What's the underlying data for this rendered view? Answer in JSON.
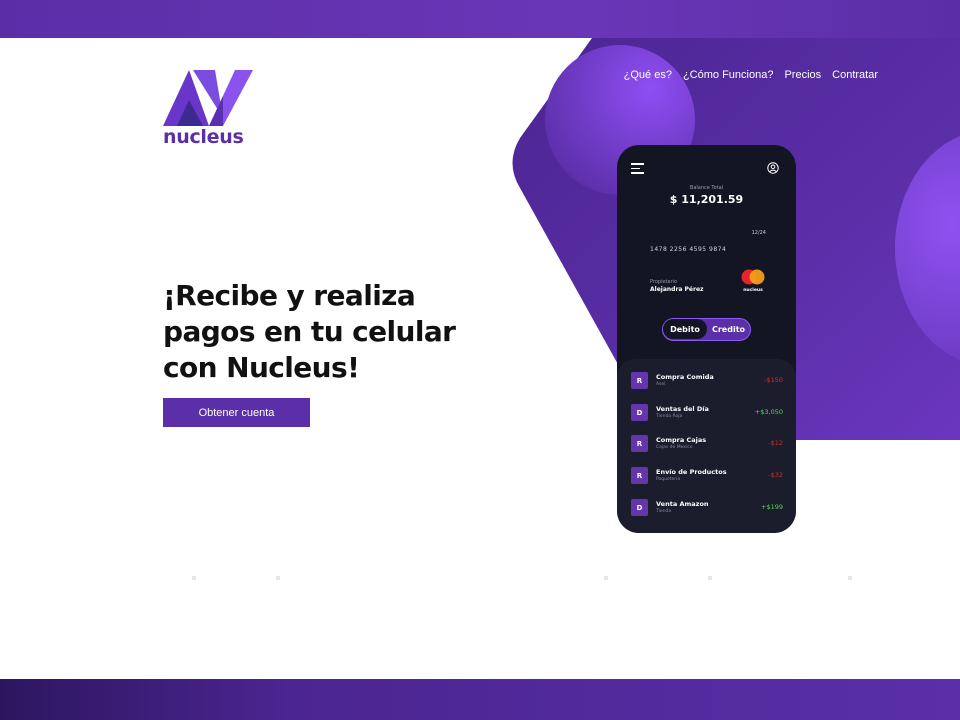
{
  "brand": {
    "name": "nucleus"
  },
  "nav": {
    "items": [
      "¿Qué es?",
      "¿Cómo Funciona?",
      "Precios",
      "Contratar"
    ]
  },
  "hero": {
    "headline_line1": "¡Recibe y realiza",
    "headline_line2": "pagos en tu celular",
    "headline_line3": "con Nucleus!",
    "cta_label": "Obtener cuenta"
  },
  "phone": {
    "balance_label": "Balance Total",
    "balance_value": "$ 11,201.59",
    "card": {
      "expiry": "12/24",
      "number": "1478 2256 4595 9874",
      "owner_label": "Propietario",
      "owner_name": "Alejandra Pérez",
      "network_label": "nucleus"
    },
    "toggle": {
      "debit": "Debito",
      "credit": "Credito",
      "selected": "Debito"
    },
    "transactions": [
      {
        "badge": "R",
        "title": "Compra Comida",
        "subtitle": "Asel",
        "amount": "-$150",
        "type": "negative"
      },
      {
        "badge": "D",
        "title": "Ventas del Día",
        "subtitle": "Tienda Roja",
        "amount": "+$3,050",
        "type": "positive"
      },
      {
        "badge": "R",
        "title": "Compra Cajas",
        "subtitle": "Cajas de Mexico",
        "amount": "-$12",
        "type": "negative"
      },
      {
        "badge": "R",
        "title": "Envío de Productos",
        "subtitle": "Paquetería",
        "amount": "-$32",
        "type": "negative"
      },
      {
        "badge": "D",
        "title": "Venta Amazon",
        "subtitle": "Tienda",
        "amount": "+$199",
        "type": "positive"
      }
    ]
  },
  "colors": {
    "brand_purple": "#5b2fa8",
    "accent_violet": "#8b5cf6",
    "phone_bg": "#141523",
    "negative": "#e5252a",
    "positive": "#4ade4a"
  },
  "icons": [
    "menu-icon",
    "profile-icon",
    "mastercard-logo",
    "nucleus-logo"
  ]
}
